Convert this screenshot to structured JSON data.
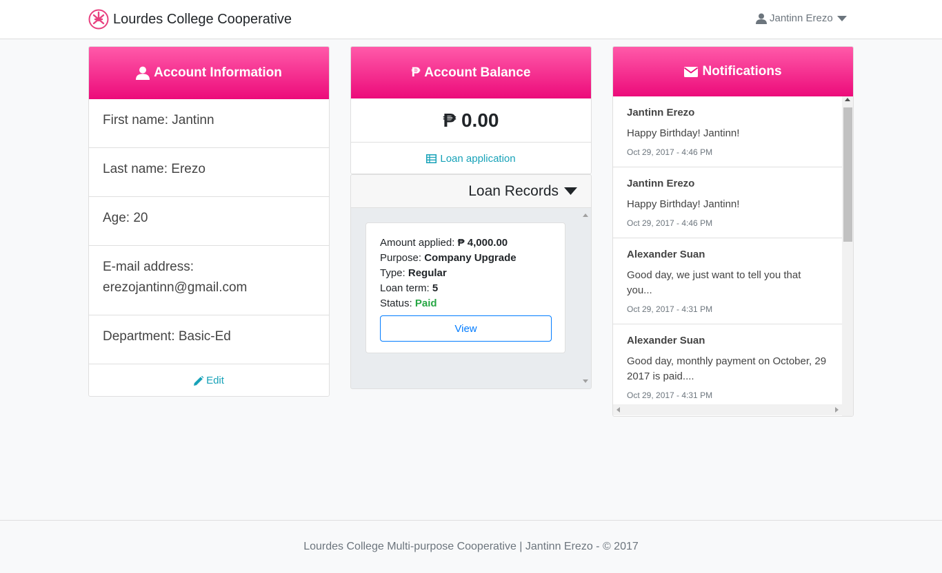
{
  "brand": {
    "name": "Lourdes College Cooperative"
  },
  "user": {
    "name": "Jantinn Erezo"
  },
  "account": {
    "title": "Account Information",
    "first_name": "First name: Jantinn",
    "last_name": "Last name: Erezo",
    "age": "Age: 20",
    "email_label": "E-mail address:",
    "email": "erezojantinn@gmail.com",
    "department": "Department: Basic-Ed",
    "edit_label": "Edit"
  },
  "balance": {
    "title": "Account Balance",
    "currency": "₱",
    "amount": "₱ 0.00",
    "loan_application_label": "Loan application"
  },
  "loan_records": {
    "title": "Loan Records",
    "items": [
      {
        "amount_label": "Amount applied:",
        "amount": "₱ 4,000.00",
        "purpose_label": "Purpose:",
        "purpose": "Company Upgrade",
        "type_label": "Type:",
        "type": "Regular",
        "term_label": "Loan term:",
        "term": "5",
        "status_label": "Status:",
        "status": "Paid",
        "view_label": "View"
      }
    ]
  },
  "notifications": {
    "title": "Notifications",
    "items": [
      {
        "from": "Jantinn Erezo",
        "message": "Happy Birthday! Jantinn!",
        "time": "Oct 29, 2017 - 4:46 PM"
      },
      {
        "from": "Jantinn Erezo",
        "message": "Happy Birthday! Jantinn!",
        "time": "Oct 29, 2017 - 4:46 PM"
      },
      {
        "from": "Alexander Suan",
        "message": "Good day, we just want to tell you that you...",
        "time": "Oct 29, 2017 - 4:31 PM"
      },
      {
        "from": "Alexander Suan",
        "message": "Good day, monthly payment on October, 29 2017 is paid....",
        "time": "Oct 29, 2017 - 4:31 PM"
      }
    ]
  },
  "footer": {
    "text": "Lourdes College Multi-purpose Cooperative | Jantinn Erezo - © 2017"
  },
  "colors": {
    "header_pink": "#ec0b7a",
    "link_teal": "#17a2b8",
    "status_green": "#28a745",
    "button_blue": "#007bff"
  }
}
